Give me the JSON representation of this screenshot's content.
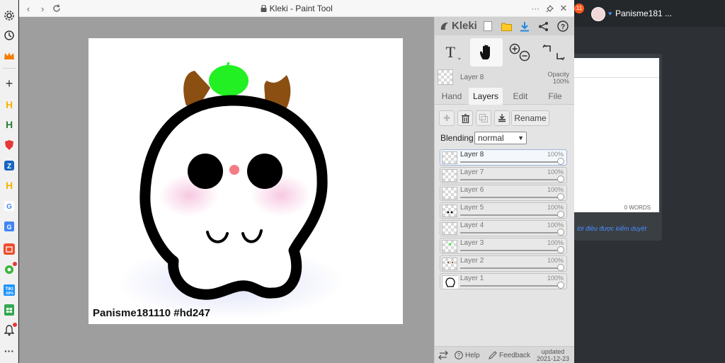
{
  "window": {
    "title": "Kleki - Paint Tool",
    "lock_icon": "lock-icon"
  },
  "canvas": {
    "caption": "Panisme181110 #hd247"
  },
  "panel": {
    "logo": "Kleki",
    "current_layer": "Layer 8",
    "opacity_label": "Opacity",
    "opacity_value": "100%",
    "tabs": [
      "Hand",
      "Layers",
      "Edit",
      "File"
    ],
    "active_tab": "Layers",
    "rename_label": "Rename",
    "blending_label": "Blending",
    "blending_value": "normal",
    "layers": [
      {
        "name": "Layer 8",
        "opacity": "100%",
        "opacity_value": 1.0,
        "active": true
      },
      {
        "name": "Layer 7",
        "opacity": "100%",
        "opacity_value": 1.0,
        "active": false
      },
      {
        "name": "Layer 6",
        "opacity": "100%",
        "opacity_value": 1.0,
        "active": false
      },
      {
        "name": "Layer 5",
        "opacity": "100%",
        "opacity_value": 1.0,
        "active": false
      },
      {
        "name": "Layer 4",
        "opacity": "100%",
        "opacity_value": 1.0,
        "active": false
      },
      {
        "name": "Layer 3",
        "opacity": "100%",
        "opacity_value": 1.0,
        "active": false
      },
      {
        "name": "Layer 2",
        "opacity": "100%",
        "opacity_value": 1.0,
        "active": false
      },
      {
        "name": "Layer 1",
        "opacity": "100%",
        "opacity_value": 1.0,
        "active": false
      }
    ],
    "footer": {
      "help": "Help",
      "feedback": "Feedback",
      "updated_label": "updated",
      "updated_date": "2021-12-23"
    }
  },
  "background_page": {
    "notification_count": "11",
    "username": "Panisme181 ...",
    "word_count": "0 WORDS",
    "note": "lời điều được kiểm duyệt"
  },
  "colors": {
    "canvas_bg": "#9e9e9e",
    "panel_bg": "#dedede",
    "accent_blue": "#1e88e5",
    "apple_green": "#22f022",
    "antler_brown": "#8b4f12"
  }
}
